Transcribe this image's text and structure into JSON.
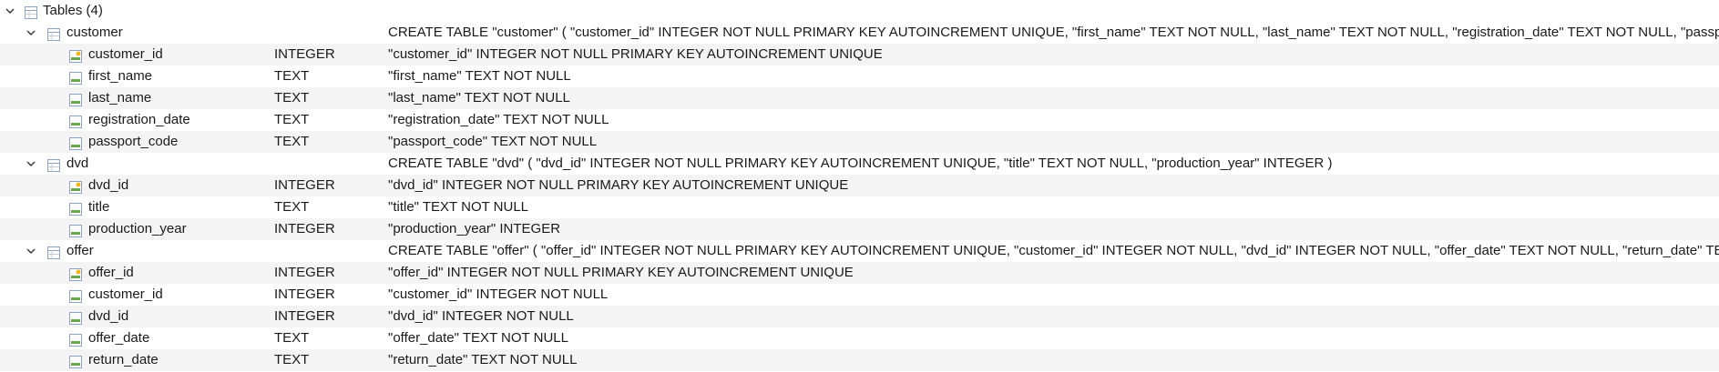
{
  "tree": {
    "root": {
      "label": "Tables (4)",
      "icon": "table-icon"
    },
    "tables": [
      {
        "name": "customer",
        "schema": "CREATE TABLE \"customer\" ( \"customer_id\" INTEGER NOT NULL PRIMARY KEY AUTOINCREMENT UNIQUE, \"first_name\" TEXT NOT NULL, \"last_name\" TEXT NOT NULL, \"registration_date\" TEXT NOT NULL, \"passport_code\" TEXT NOT NULL )",
        "fields": [
          {
            "name": "customer_id",
            "type": "INTEGER",
            "schema": "\"customer_id\" INTEGER NOT NULL PRIMARY KEY AUTOINCREMENT UNIQUE",
            "key": true
          },
          {
            "name": "first_name",
            "type": "TEXT",
            "schema": "\"first_name\" TEXT NOT NULL",
            "key": false
          },
          {
            "name": "last_name",
            "type": "TEXT",
            "schema": "\"last_name\" TEXT NOT NULL",
            "key": false
          },
          {
            "name": "registration_date",
            "type": "TEXT",
            "schema": "\"registration_date\" TEXT NOT NULL",
            "key": false
          },
          {
            "name": "passport_code",
            "type": "TEXT",
            "schema": "\"passport_code\" TEXT NOT NULL",
            "key": false
          }
        ]
      },
      {
        "name": "dvd",
        "schema": "CREATE TABLE \"dvd\" ( \"dvd_id\" INTEGER NOT NULL PRIMARY KEY AUTOINCREMENT UNIQUE, \"title\" TEXT NOT NULL, \"production_year\" INTEGER )",
        "fields": [
          {
            "name": "dvd_id",
            "type": "INTEGER",
            "schema": "\"dvd_id\" INTEGER NOT NULL PRIMARY KEY AUTOINCREMENT UNIQUE",
            "key": true
          },
          {
            "name": "title",
            "type": "TEXT",
            "schema": "\"title\" TEXT NOT NULL",
            "key": false
          },
          {
            "name": "production_year",
            "type": "INTEGER",
            "schema": "\"production_year\" INTEGER",
            "key": false
          }
        ]
      },
      {
        "name": "offer",
        "schema": "CREATE TABLE \"offer\" ( \"offer_id\" INTEGER NOT NULL PRIMARY KEY AUTOINCREMENT UNIQUE, \"customer_id\" INTEGER NOT NULL, \"dvd_id\" INTEGER NOT NULL, \"offer_date\" TEXT NOT NULL, \"return_date\" TEXT NOT NULL )",
        "fields": [
          {
            "name": "offer_id",
            "type": "INTEGER",
            "schema": "\"offer_id\" INTEGER NOT NULL PRIMARY KEY AUTOINCREMENT UNIQUE",
            "key": true
          },
          {
            "name": "customer_id",
            "type": "INTEGER",
            "schema": "\"customer_id\" INTEGER NOT NULL",
            "key": false
          },
          {
            "name": "dvd_id",
            "type": "INTEGER",
            "schema": "\"dvd_id\" INTEGER NOT NULL",
            "key": false
          },
          {
            "name": "offer_date",
            "type": "TEXT",
            "schema": "\"offer_date\" TEXT NOT NULL",
            "key": false
          },
          {
            "name": "return_date",
            "type": "TEXT",
            "schema": "\"return_date\" TEXT NOT NULL",
            "key": false
          }
        ]
      }
    ]
  },
  "icons": {
    "twisty": "chevron-down-icon",
    "table": "table-icon",
    "field": "field-icon",
    "key_field": "key-field-icon"
  },
  "colors": {
    "alt_row": "#f4f4f4",
    "icon_border": "#8fa3bf",
    "field_green": "#6aa84f",
    "key_yellow": "#e8b820"
  }
}
